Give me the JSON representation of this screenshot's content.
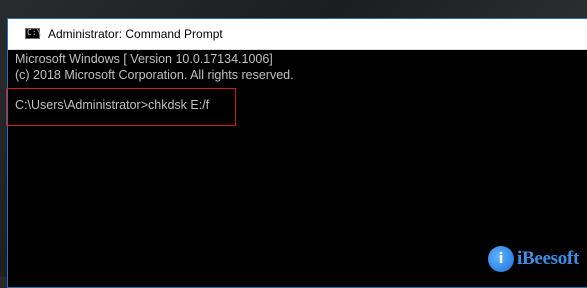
{
  "window": {
    "title": "Administrator: Command Prompt",
    "icon": "cmd-icon",
    "icon_glyph": "C:\\"
  },
  "console": {
    "lines": [
      "Microsoft Windows [ Version 10.0.17134.1006]",
      "(c) 2018 Microsoft Corporation. All rights reserved.",
      "C:\\Users\\Administrator>chkdsk E:/f"
    ],
    "text_color": "#c0c0c0",
    "highlight_color": "#d01c1c"
  },
  "watermark": {
    "logo_text": "iBeesoft",
    "icon": "ibeesoft-logo-icon",
    "icon_glyph": "i",
    "brand_color": "#3a8fe8"
  },
  "colors": {
    "window_border": "#2d6fb3",
    "console_bg": "#000000",
    "titlebar_bg": "#ffffff"
  }
}
